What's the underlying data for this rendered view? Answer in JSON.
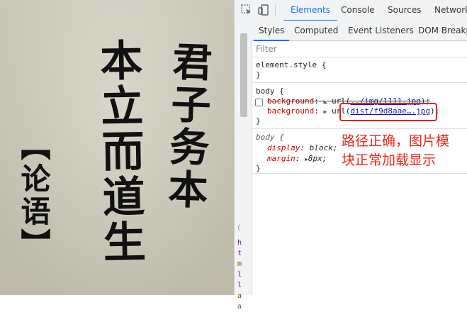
{
  "page": {
    "calligraphy": {
      "column1": "君子务本",
      "column2": "本立而道生",
      "column3": "【论语】"
    }
  },
  "devtools": {
    "tabs": [
      "Elements",
      "Console",
      "Sources",
      "Network"
    ],
    "active_tab": "Elements",
    "subtabs": [
      "Styles",
      "Computed",
      "Event Listeners",
      "DOM Breakpo"
    ],
    "active_subtab": "Styles",
    "filter_placeholder": "Filter",
    "rules": {
      "element_style": {
        "selector": "element.style {",
        "close": "}"
      },
      "body1": {
        "selector": "body {",
        "overridden": {
          "prop": "background",
          "value_prefix": "url(",
          "url": "../img/1111.jpg",
          "value_suffix": ");"
        },
        "active": {
          "prop": "background",
          "value_prefix": "url(",
          "url": "dist/f9d8aae….jpg",
          "value_suffix": ");"
        },
        "close": "}"
      },
      "body2": {
        "selector": "body {",
        "decl1": {
          "prop": "display",
          "value": "block;"
        },
        "decl2": {
          "prop": "margin",
          "value": "8px;"
        },
        "close": "}"
      }
    },
    "gutter_chars": [
      "h",
      "t",
      "m",
      "l",
      "l",
      "a",
      "a"
    ],
    "annotation": {
      "line1": "路径正确，图片模",
      "line2": "块正常加载显示",
      "color": "#e8251b"
    }
  }
}
